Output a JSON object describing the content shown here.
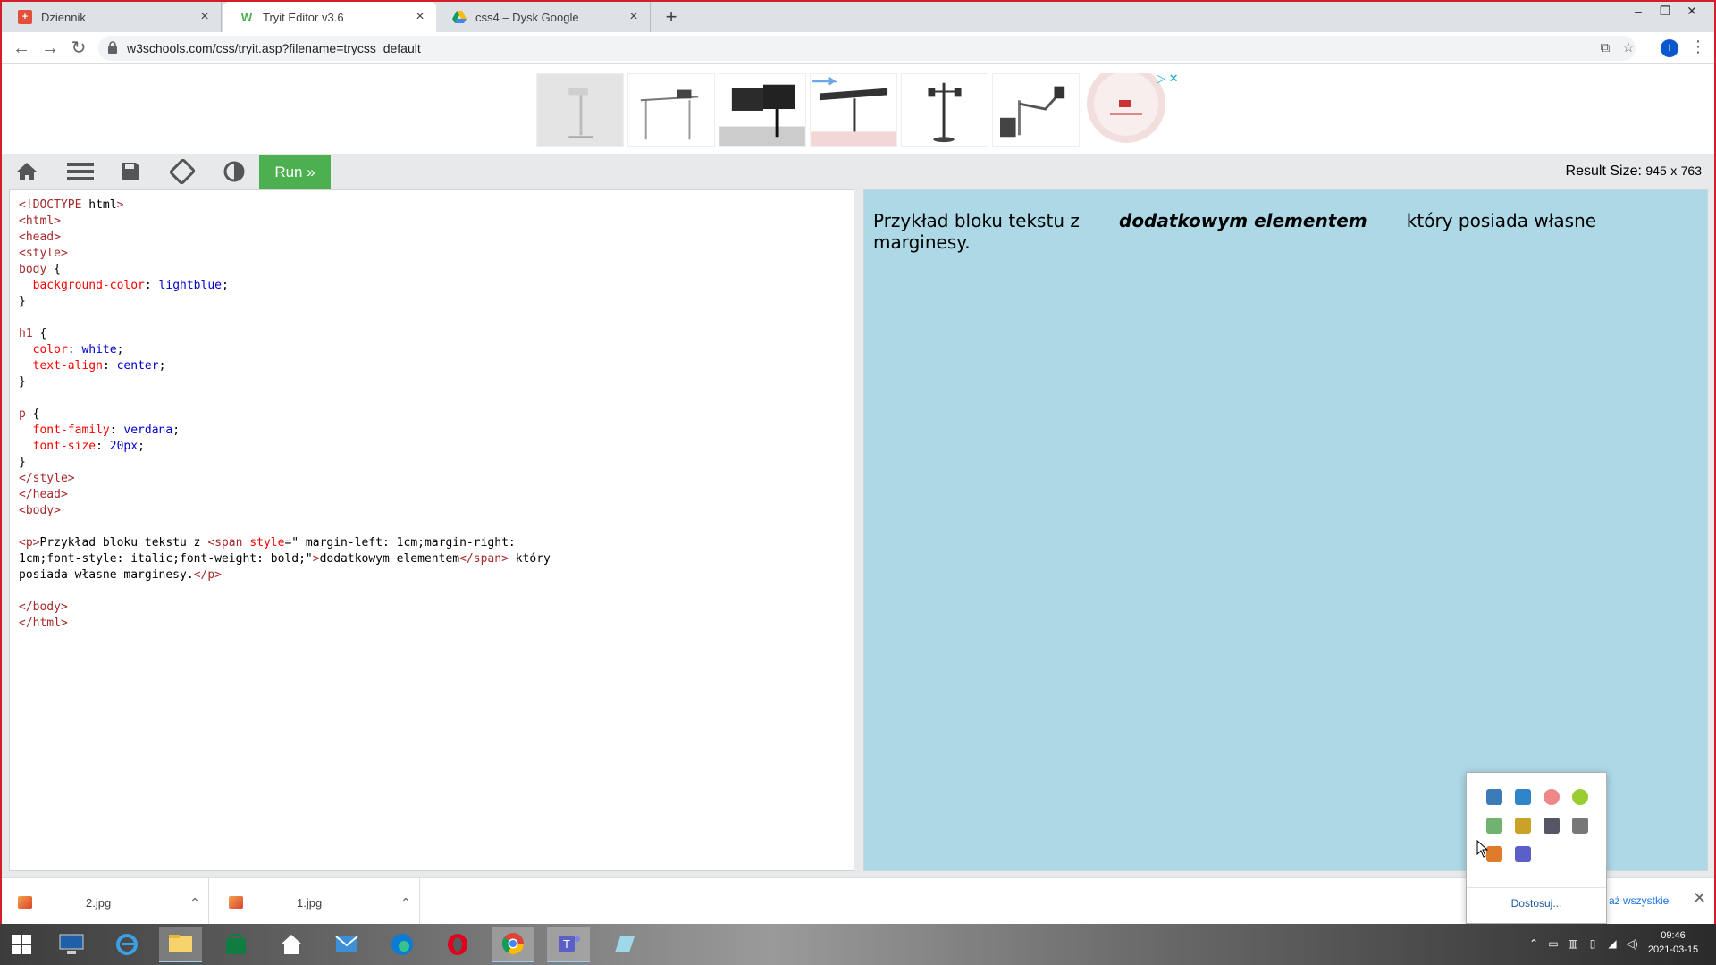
{
  "browser": {
    "tabs": [
      {
        "title": "Dziennik",
        "icon": "librus-icon",
        "active": false
      },
      {
        "title": "Tryit Editor v3.6",
        "icon": "w3schools-icon",
        "active": true
      },
      {
        "title": "css4 – Dysk Google",
        "icon": "google-drive-icon",
        "active": false
      }
    ],
    "new_tab_label": "+",
    "url": "w3schools.com/css/tryit.asp?filename=trycss_default",
    "profile_initial": "I"
  },
  "ads": {
    "choices_label": "▷ ✕",
    "thumbnails": [
      "ad-thumb-1",
      "ad-thumb-2",
      "ad-thumb-3",
      "ad-thumb-4",
      "ad-thumb-5",
      "ad-thumb-6",
      "ad-thumb-7"
    ]
  },
  "w3toolbar": {
    "run_label": "Run »",
    "result_size_label": "Result Size:",
    "result_width": "945",
    "result_x": "x",
    "result_height": "763"
  },
  "editor": {
    "lines": [
      "<!DOCTYPE html>",
      "<html>",
      "<head>",
      "<style>",
      "body {",
      "  background-color: lightblue;",
      "}",
      "",
      "h1 {",
      "  color: white;",
      "  text-align: center;",
      "}",
      "",
      "p {",
      "  font-family: verdana;",
      "  font-size: 20px;",
      "}",
      "</style>",
      "</head>",
      "<body>",
      "",
      "<p>Przykład bloku tekstu z <span style=\" margin-left: 1cm;margin-right:",
      "1cm;font-style: italic;font-weight: bold;\">dodatkowym elementem</span> który",
      "posiada własne marginesy.</p>",
      "",
      "</body>",
      "</html>"
    ]
  },
  "result": {
    "text_before": "Przykład bloku tekstu z ",
    "span_text": "dodatkowym elementem",
    "text_after": " który posiada własne marginesy."
  },
  "downloads": {
    "items": [
      {
        "name": "2.jpg"
      },
      {
        "name": "1.jpg"
      }
    ],
    "show_all_label": "aż wszystkie",
    "close_label": "✕"
  },
  "tray_popup": {
    "customize_label": "Dostosuj..."
  },
  "clock": {
    "time": "09:46",
    "date": "2021-03-15"
  }
}
